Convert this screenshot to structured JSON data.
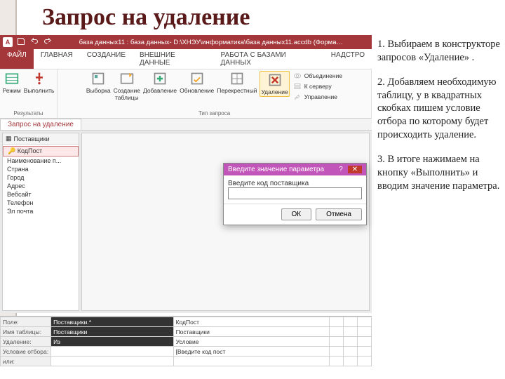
{
  "slide_title": "Запрос на удаление",
  "instructions": {
    "p1": "1. Выбираем в конструкторе запросов «Удаление» .",
    "p2": "2. Добавляем необходимую таблицу, у в квадратных скобках пишем условие отбора по которому будет происходить удаление.",
    "p3": "3. В итоге нажимаем на кнопку «Выполнить» и вводим значение параметра."
  },
  "access": {
    "title_caption": "база данных11 : база данных- D:\\ХНЭУ\\информатика\\база данных11.accdb (Форма…",
    "tabs": {
      "file": "ФАЙЛ",
      "home": "ГЛАВНАЯ",
      "create": "СОЗДАНИЕ",
      "external": "ВНЕШНИЕ ДАННЫЕ",
      "dbtools": "РАБОТА С БАЗАМИ ДАННЫХ",
      "addin": "НАДСТРО"
    },
    "ribbon": {
      "group_results": "Результаты",
      "group_querytype": "Тип запроса",
      "btn_view": "Режим",
      "btn_run": "Выполнить",
      "btn_select": "Выборка",
      "btn_maketable": "Создание\nтаблицы",
      "btn_append": "Добавление",
      "btn_update": "Обновление",
      "btn_crosstab": "Перекрестный",
      "btn_delete": "Удаление",
      "btn_union": "Объединение",
      "btn_passthrough": "К серверу",
      "btn_datadef": "Управление"
    },
    "doc_tab": "Запрос на удаление",
    "nav": {
      "header": "Поставщики",
      "items": [
        "КодПост",
        "Наименование п...",
        "Страна",
        "Город",
        "Адрес",
        "Вебсайт",
        "Телефон",
        "Эл почта"
      ]
    },
    "qbe": {
      "rows": {
        "field": "Поле:",
        "table": "Имя таблицы:",
        "delete": "Удаление:",
        "criteria": "Условие отбора:",
        "or": "или:"
      },
      "c1": {
        "field": "Поставщики.*",
        "table": "Поставщики",
        "delete": "Из",
        "criteria": ""
      },
      "c2": {
        "field": "КодПост",
        "table": "Поставщики",
        "delete": "Условие",
        "criteria": "[Введите код пост"
      }
    },
    "dialog": {
      "title": "Введите значение параметра",
      "help": "?",
      "label": "Введите код поставщика",
      "value": "",
      "ok": "ОК",
      "cancel": "Отмена"
    }
  }
}
